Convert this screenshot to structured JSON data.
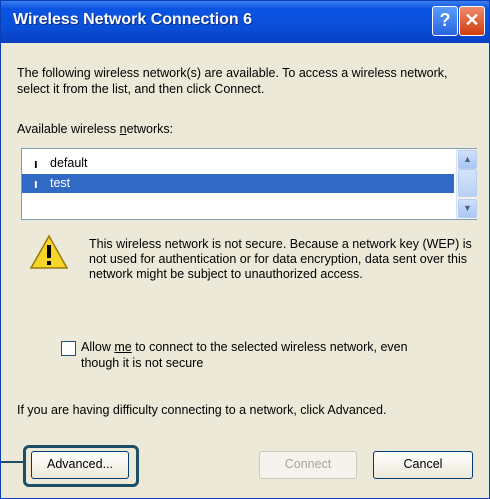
{
  "window": {
    "title": "Wireless Network Connection 6",
    "help_glyph": "?",
    "close_glyph": "✕"
  },
  "intro_text": "The following wireless network(s) are available. To access a wireless network, select it from the list, and then click Connect.",
  "available_label": {
    "prefix": "Available wireless ",
    "underlined": "n",
    "suffix": "etworks:"
  },
  "networks": [
    {
      "name": "default",
      "icon": "wireless-antenna-icon",
      "selected": false
    },
    {
      "name": "test",
      "icon": "wireless-antenna-icon",
      "selected": true
    }
  ],
  "warning_text": "This wireless network is not secure. Because a network key (WEP) is not used for authentication or for data encryption, data sent over this network might be subject to unauthorized access.",
  "allow_checkbox": {
    "checked": false,
    "label_prefix": "Allow ",
    "label_underlined": "me",
    "label_suffix": " to connect to the selected wireless network, even though it is not secure"
  },
  "advanced_hint": "If you are having difficulty connecting to a network, click Advanced.",
  "buttons": {
    "advanced": "Advanced...",
    "connect": "Connect",
    "cancel": "Cancel"
  },
  "colors": {
    "titlebar": "#0a4fd9",
    "selection": "#316ac5",
    "dialog_bg": "#ece9d8",
    "callout": "#1d4f67"
  }
}
